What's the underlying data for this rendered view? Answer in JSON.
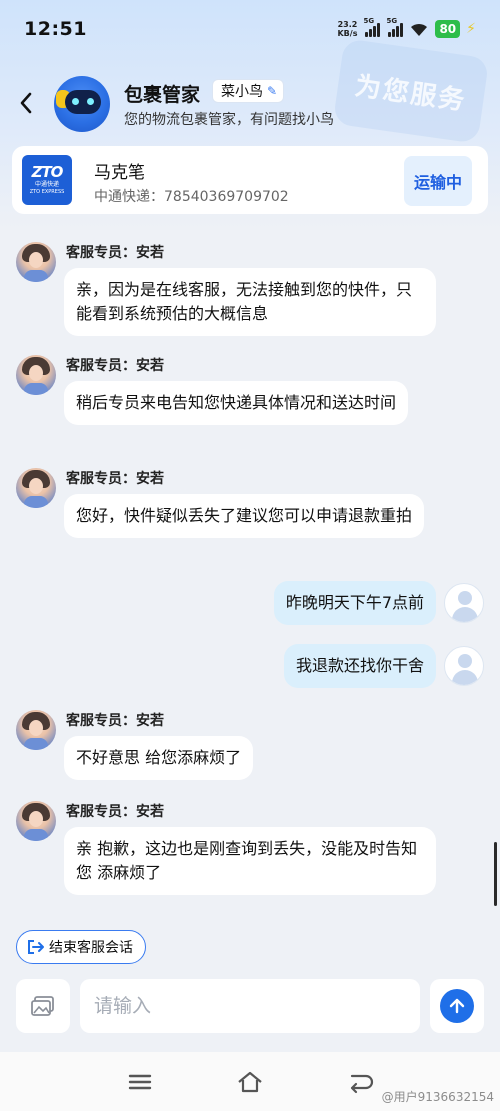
{
  "status_bar": {
    "time": "12:51",
    "net_speed_value": "23.2",
    "net_speed_unit": "KB/s",
    "sim1_tag": "5G",
    "sim2_tag": "5G",
    "battery": "80"
  },
  "header": {
    "title": "包裹管家",
    "chip_name": "菜小鸟",
    "subtitle": "您的物流包裹管家，有问题找小鸟",
    "watermark": "为您服务"
  },
  "package": {
    "logo_big": "ZTO",
    "logo_small": "中通快递",
    "logo_tiny": "ZTO EXPRESS",
    "name": "马克笔",
    "tracking": "中通快递：78540369709702",
    "status": "运输中"
  },
  "messages": [
    {
      "from": "agent",
      "name": "客服专员：安若",
      "text": "亲，因为是在线客服，无法接触到您的快件，只能看到系统预估的大概信息"
    },
    {
      "from": "agent",
      "name": "客服专员：安若",
      "text": "稍后专员来电告知您快递具体情况和送达时间"
    },
    {
      "from": "agent",
      "name": "客服专员：安若",
      "text": "您好，快件疑似丢失了建议您可以申请退款重拍"
    },
    {
      "from": "user",
      "text": "昨晚明天下午7点前"
    },
    {
      "from": "user",
      "text": "我退款还找你干舍"
    },
    {
      "from": "agent",
      "name": "客服专员：安若",
      "text": "不好意思 给您添麻烦了"
    },
    {
      "from": "agent",
      "name": "客服专员：安若",
      "text": "亲 抱歉，这边也是刚查询到丢失，没能及时告知您 添麻烦了"
    }
  ],
  "actions": {
    "end_session": "结束客服会话"
  },
  "input": {
    "placeholder": "请输入"
  },
  "watermark_footer": "@用户9136632154",
  "colors": {
    "accent": "#1f6fe8",
    "user_bubble": "#daeffc",
    "status_chip_bg": "#e4f0fd"
  }
}
